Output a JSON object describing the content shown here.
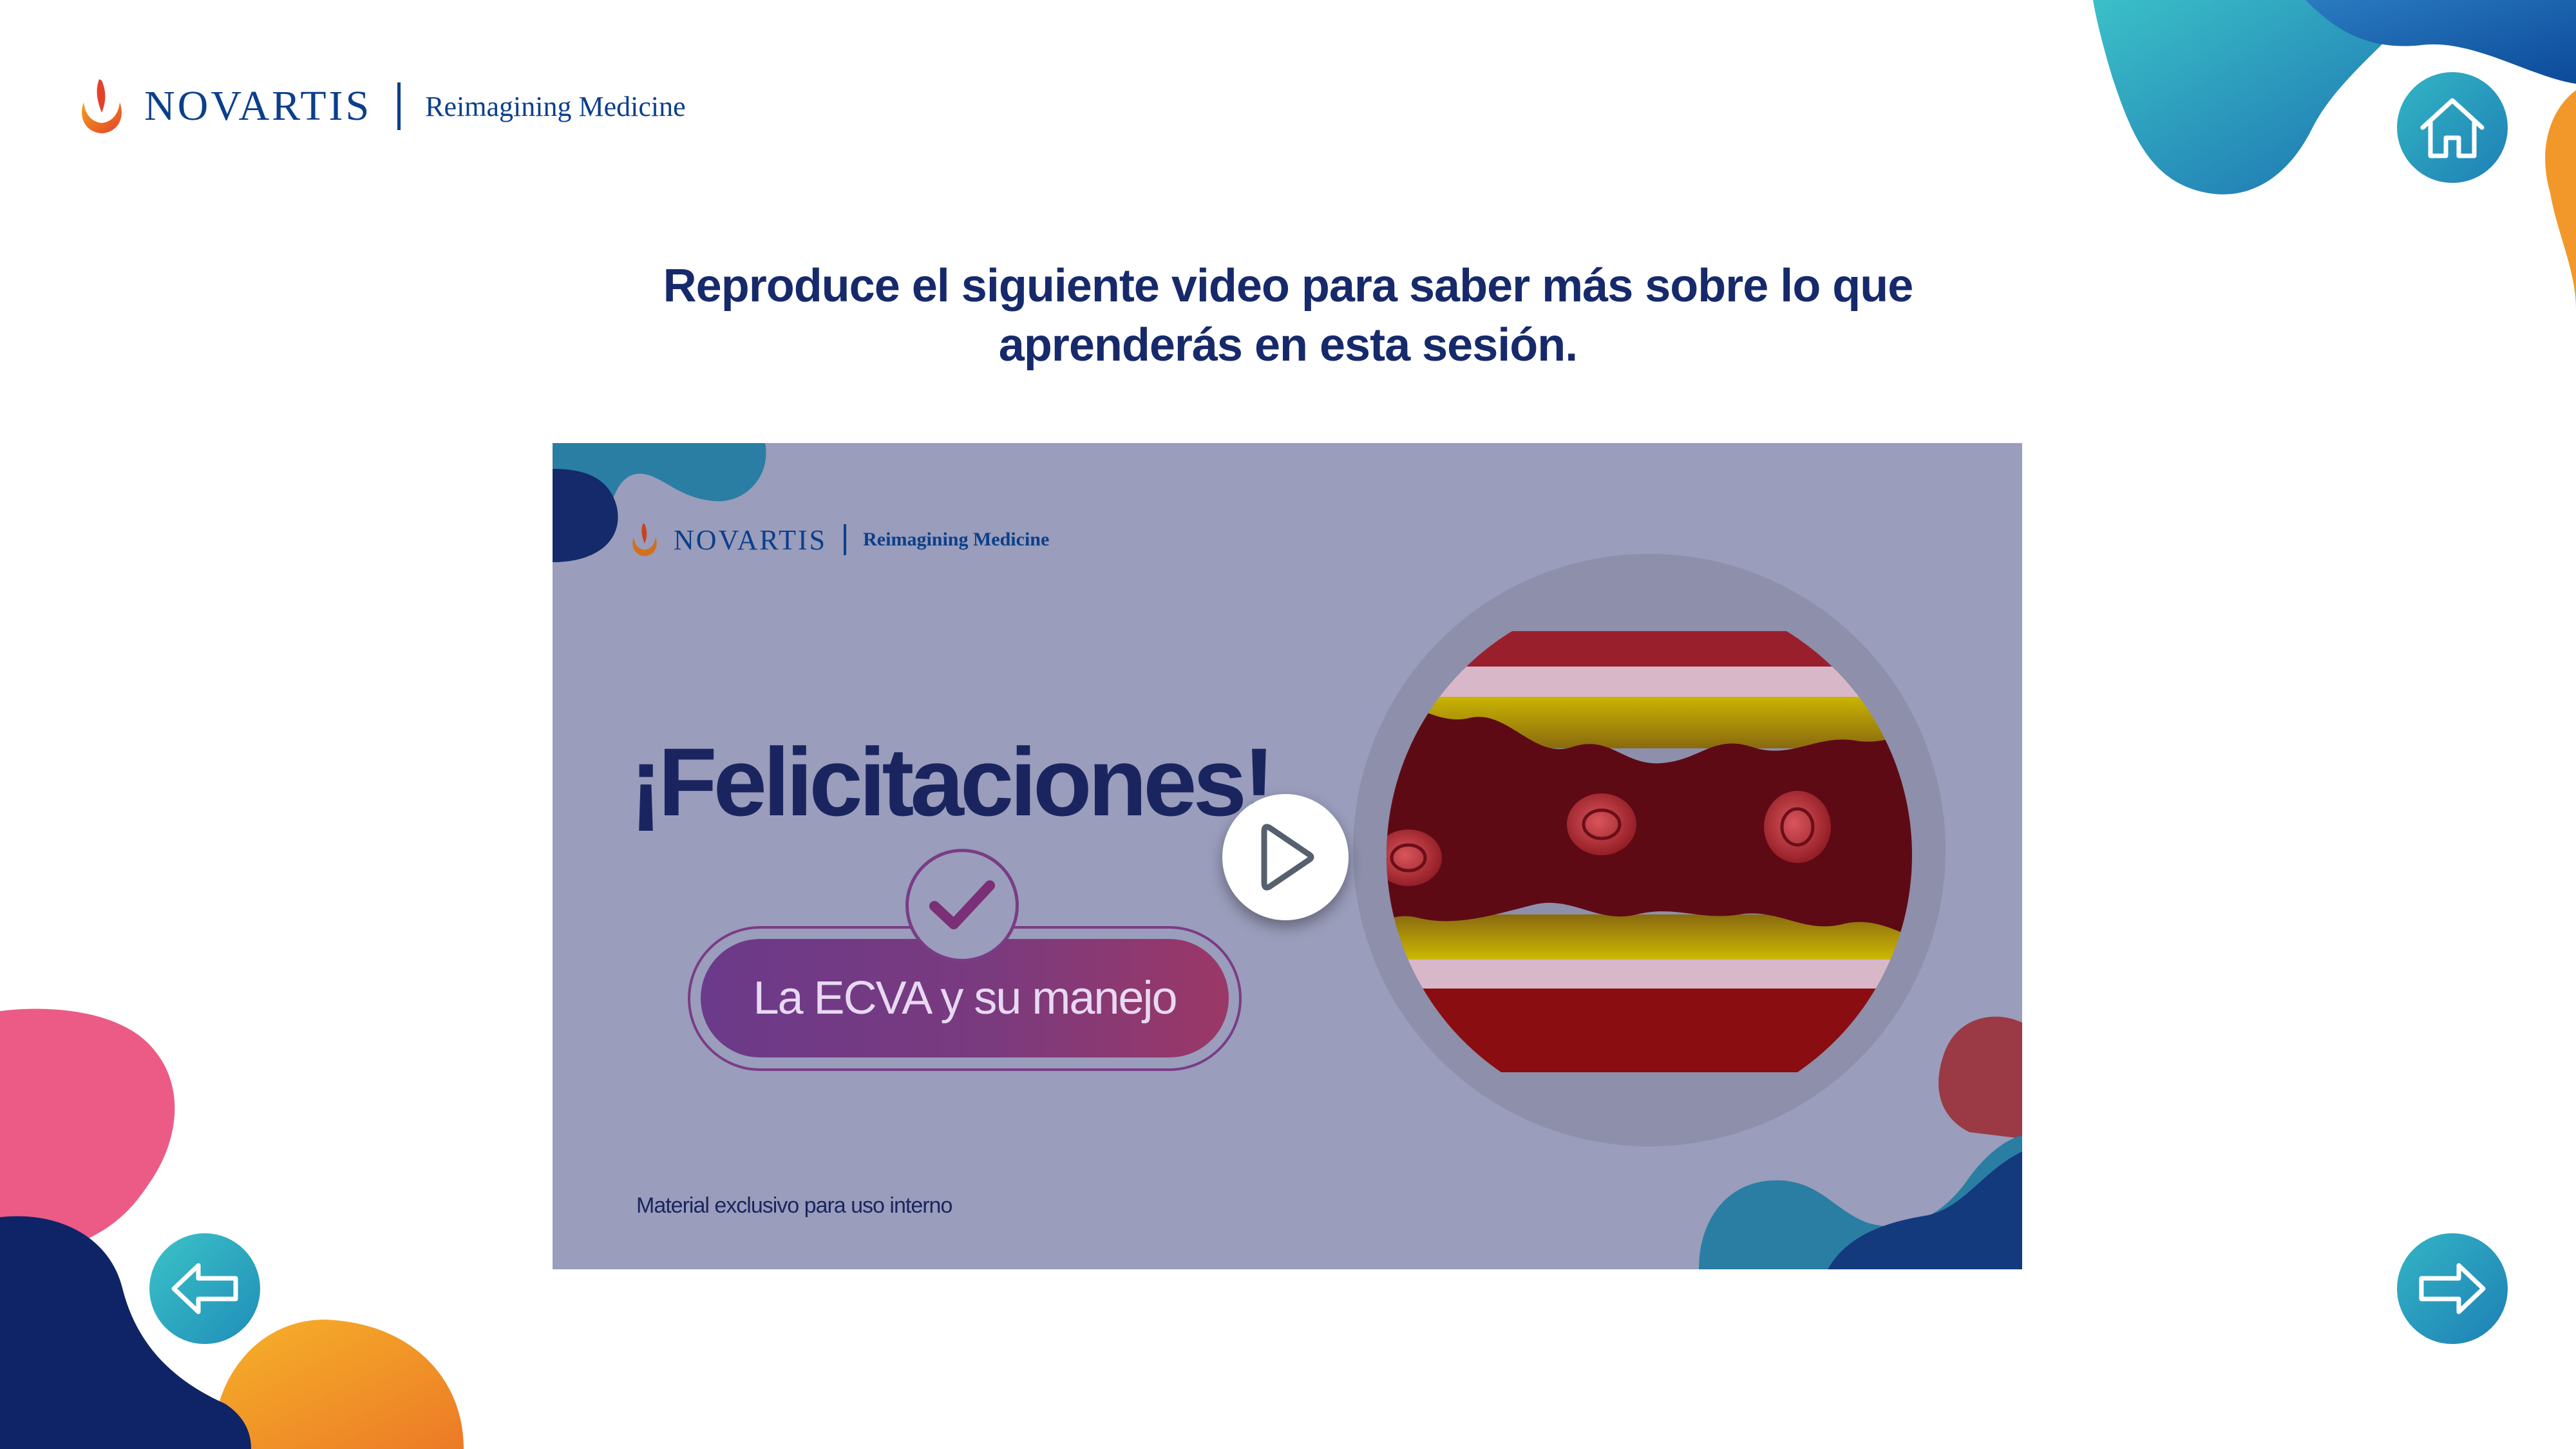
{
  "brand": {
    "name": "NOVARTIS",
    "tagline": "Reimagining Medicine"
  },
  "heading": {
    "line1": "Reproduce el siguiente video para saber más sobre lo que",
    "line2": "aprenderás en esta sesión."
  },
  "video": {
    "brand_name": "NOVARTIS",
    "brand_tagline": "Reimagining Medicine",
    "title": "¡Felicitaciones!",
    "course_label": "La ECVA y su manejo",
    "footnote": "Material exclusivo para uso interno",
    "play_icon": "play-icon",
    "background_color": "#9a9dbb"
  },
  "navigation": {
    "home_icon": "home-icon",
    "prev_icon": "arrow-left-icon",
    "next_icon": "arrow-right-icon"
  },
  "colors": {
    "brand_blue": "#0b3f8c",
    "heading_navy": "#162a6b",
    "teal": "#2aa6c2",
    "orange": "#f2982a",
    "pink": "#ec5b86",
    "navy": "#0e2466"
  }
}
